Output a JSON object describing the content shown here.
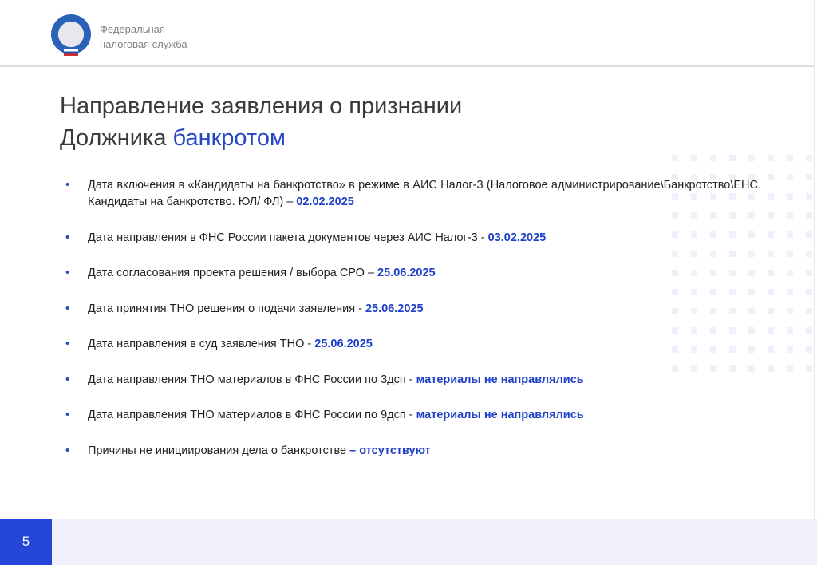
{
  "header": {
    "org_line1": "Федеральная",
    "org_line2": "налоговая служба"
  },
  "title": {
    "line1": "Направление заявления о признании",
    "line2_plain": "Должника ",
    "line2_highlight": "банкротом"
  },
  "items": [
    {
      "text": "Дата включения в «Кандидаты на банкротство» в режиме в АИС Налог-3 (Налоговое администрирование\\Банкротство\\ЕНС. Кандидаты на банкротство. ЮЛ/ ФЛ) – ",
      "value": "02.02.2025"
    },
    {
      "text": "Дата направления в ФНС России пакета документов через АИС Налог-3 - ",
      "value": "03.02.2025"
    },
    {
      "text": "Дата согласования проекта решения / выбора СРО – ",
      "value": "25.06.2025"
    },
    {
      "text": "Дата принятия ТНО решения о подачи заявления - ",
      "value": "25.06.2025"
    },
    {
      "text": "Дата направления в суд заявления ТНО - ",
      "value": "25.06.2025"
    },
    {
      "text": "Дата направления ТНО материалов в ФНС России по 3дсп  - ",
      "value": "материалы не направлялись"
    },
    {
      "text": "Дата направления ТНО материалов в ФНС России по 9дсп  - ",
      "value": "материалы не направлялись"
    },
    {
      "text": "Причины не инициирования дела о банкротстве ",
      "value": "– отсутствуют"
    }
  ],
  "footer": {
    "page_number": "5"
  }
}
